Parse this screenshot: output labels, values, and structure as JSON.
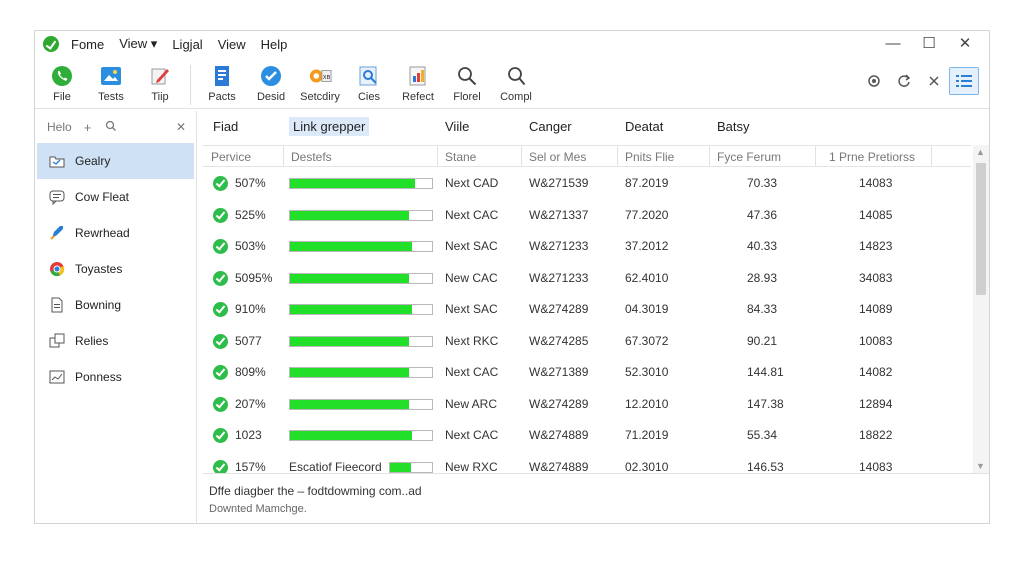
{
  "menu": [
    "Fome",
    "View ▾",
    "Ligjal",
    "View",
    "Help"
  ],
  "window_controls": [
    "—",
    "☐",
    "✕"
  ],
  "toolbar": {
    "group1": [
      {
        "label": "File",
        "icon": "phone-icon"
      },
      {
        "label": "Tests",
        "icon": "photo-icon"
      },
      {
        "label": "Tiip",
        "icon": "edit-icon"
      }
    ],
    "group2": [
      {
        "label": "Pacts",
        "icon": "document-icon"
      },
      {
        "label": "Desid",
        "icon": "check-icon"
      },
      {
        "label": "Setcdiry",
        "icon": "settings-icon"
      },
      {
        "label": "Cies",
        "icon": "inspect-icon"
      },
      {
        "label": "Refect",
        "icon": "report-icon"
      },
      {
        "label": "Florel",
        "icon": "search-icon"
      },
      {
        "label": "Compl",
        "icon": "zoom-icon"
      }
    ]
  },
  "sidebar": {
    "header": {
      "label": "Helo",
      "add": "+",
      "close": "✕"
    },
    "items": [
      {
        "label": "Gealry",
        "icon": "folder-icon",
        "selected": true
      },
      {
        "label": "Cow Fleat",
        "icon": "chat-icon"
      },
      {
        "label": "Rewrhead",
        "icon": "rocket-icon"
      },
      {
        "label": "Toyastes",
        "icon": "chrome-icon"
      },
      {
        "label": "Bowning",
        "icon": "file-icon"
      },
      {
        "label": "Relies",
        "icon": "layers-icon"
      },
      {
        "label": "Ponness",
        "icon": "chart-icon"
      }
    ]
  },
  "group_headers": [
    "Fiad",
    "Link grepper",
    "Viile",
    "Canger",
    "Deatat",
    "Batsy"
  ],
  "columns": [
    "Pervice",
    "Destefs",
    "Stane",
    "Sel or Mes",
    "Pnits Flie",
    "Fyce Ferum",
    "1 Prne Pretiorss"
  ],
  "rows": [
    {
      "pct": "507%",
      "progress": 0.88,
      "status": "Next CAD",
      "id": "W&271539",
      "date": "87.2019",
      "val1": "70.33",
      "val2": "14083"
    },
    {
      "pct": "525%",
      "progress": 0.84,
      "status": "Next CAC",
      "id": "W&271337",
      "date": "77.2020",
      "val1": "47.36",
      "val2": "14085"
    },
    {
      "pct": "503%",
      "progress": 0.86,
      "status": "Next SAC",
      "id": "W&271233",
      "date": "37.2012",
      "val1": "40.33",
      "val2": "14823"
    },
    {
      "pct": "5095%",
      "progress": 0.84,
      "status": "New CAC",
      "id": "W&271233",
      "date": "62.4010",
      "val1": "28.93",
      "val2": "34083"
    },
    {
      "pct": "910%",
      "progress": 0.86,
      "status": "Next SAC",
      "id": "W&274289",
      "date": "04.3019",
      "val1": "84.33",
      "val2": "14089"
    },
    {
      "pct": "5077",
      "progress": 0.84,
      "status": "Next RKC",
      "id": "W&274285",
      "date": "67.3072",
      "val1": "90.21",
      "val2": "10083"
    },
    {
      "pct": "809%",
      "progress": 0.84,
      "status": "Next CAC",
      "id": "W&271389",
      "date": "52.3010",
      "val1": "144.81",
      "val2": "14082"
    },
    {
      "pct": "207%",
      "progress": 0.84,
      "status": "New ARC",
      "id": "W&274289",
      "date": "12.2010",
      "val1": "147.38",
      "val2": "12894"
    },
    {
      "pct": "1023",
      "progress": 0.86,
      "status": "Next CAC",
      "id": "W&274889",
      "date": "71.2019",
      "val1": "55.34",
      "val2": "18822"
    },
    {
      "pct": "157%",
      "progress": 0.5,
      "overlay": "Escatiof Fieecord",
      "status": "New RXC",
      "id": "W&274889",
      "date": "02.3010",
      "val1": "146.53",
      "val2": "14083"
    }
  ],
  "status": {
    "line1": "Dffe diagber the – fodtdowming com..ad",
    "line2": "Downted Mamchge."
  },
  "colors": {
    "accent": "#2a7fd4",
    "progress": "#22e02a",
    "selection": "#cfe1f4",
    "check": "#2ebd4a"
  }
}
